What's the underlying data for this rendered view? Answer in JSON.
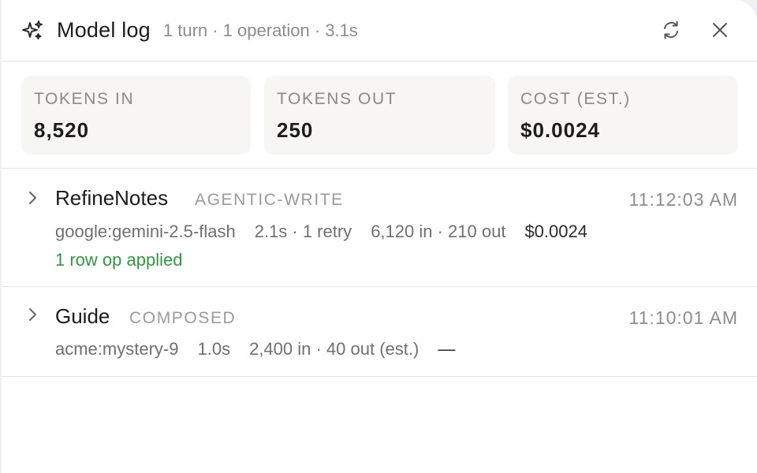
{
  "header": {
    "title": "Model log",
    "subtitle": "1 turn · 1 operation · 3.1s",
    "icons": {
      "sparkle": "sparkle-icon",
      "refresh": "refresh-icon",
      "close": "close-icon"
    }
  },
  "stats": [
    {
      "label": "TOKENS IN",
      "value": "8,520"
    },
    {
      "label": "TOKENS OUT",
      "value": "250"
    },
    {
      "label": "COST (EST.)",
      "value": "$0.0024"
    }
  ],
  "operations": [
    {
      "name": "RefineNotes",
      "tag": "AGENTIC-WRITE",
      "time": "11:12:03 AM",
      "model": "google:gemini-2.5-flash",
      "duration": "2.1s · 1 retry",
      "tokens": "6,120 in · 210 out",
      "cost": "$0.0024",
      "status": "1 row op applied"
    },
    {
      "name": "Guide",
      "tag": "COMPOSED",
      "time": "11:10:01 AM",
      "model": "acme:mystery-9",
      "duration": "1.0s",
      "tokens": "2,400 in · 40 out (est.)",
      "cost": "—"
    }
  ],
  "colors": {
    "accent_green": "#2e9b3e",
    "card_bg": "#f7f6f3",
    "divider": "#e6e4df"
  }
}
